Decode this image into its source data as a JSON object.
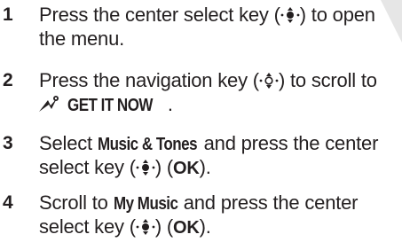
{
  "steps": [
    {
      "num": "1",
      "line1_a": "Press the center select key (",
      "line1_b": ") to open",
      "line2": "the menu."
    },
    {
      "num": "2",
      "line1_a": "Press the navigation key (",
      "line1_b": ") to scroll to",
      "line2_bold": "GET IT NOW",
      "line2_end": "."
    },
    {
      "num": "3",
      "line1_a": "Select ",
      "line1_bold": "Music & Tones",
      "line1_b": " and press the center",
      "line2_a": "select key (",
      "line2_b": ") (",
      "line2_bold": "OK",
      "line2_c": ")."
    },
    {
      "num": "4",
      "line1_a": "Scroll to ",
      "line1_bold": "My Music",
      "line1_b": " and press the center",
      "line2_a": "select key (",
      "line2_b": ") (",
      "line2_bold": "OK",
      "line2_c": ")."
    }
  ],
  "icons": {
    "select_key": "center-select-key-icon",
    "nav_key": "navigation-key-icon",
    "get_it_now": "get-it-now-icon"
  }
}
